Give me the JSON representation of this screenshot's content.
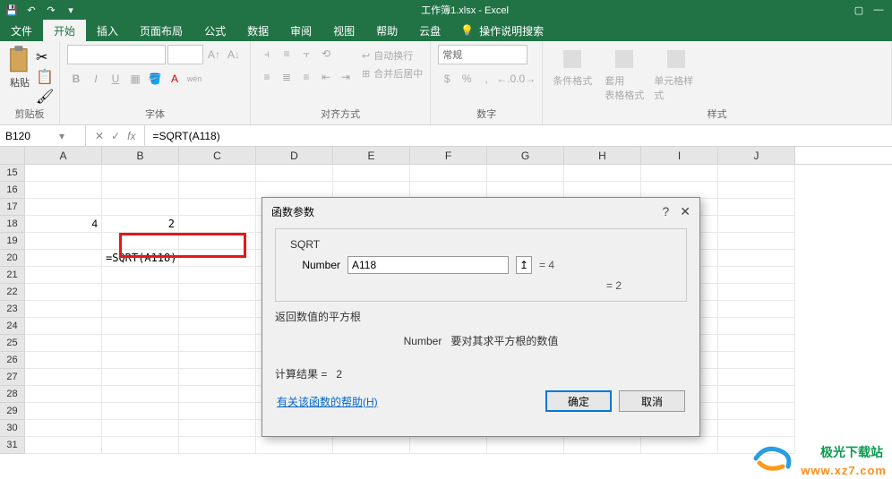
{
  "titlebar": {
    "title": "工作簿1.xlsx - Excel"
  },
  "tabs": {
    "file": "文件",
    "home": "开始",
    "insert": "插入",
    "layout": "页面布局",
    "formulas": "公式",
    "data": "数据",
    "review": "审阅",
    "view": "视图",
    "help": "帮助",
    "cloud": "云盘",
    "search": "操作说明搜索"
  },
  "ribbon": {
    "clipboard": {
      "paste": "粘贴",
      "label": "剪贴板"
    },
    "font": {
      "label": "字体",
      "bold": "B",
      "italic": "I",
      "underline": "U",
      "wen": "wén"
    },
    "align": {
      "label": "对齐方式",
      "wrap": "自动换行",
      "merge": "合并后居中"
    },
    "number": {
      "label": "数字",
      "format": "常规"
    },
    "styles": {
      "label": "样式",
      "cond": "条件格式",
      "table": "套用\n表格格式",
      "cell": "单元格样式"
    }
  },
  "formula_bar": {
    "name_box": "B120",
    "formula": "=SQRT(A118)"
  },
  "columns": [
    "A",
    "B",
    "C",
    "D",
    "E",
    "F",
    "G",
    "H",
    "I",
    "J"
  ],
  "rows": [
    "15",
    "16",
    "17",
    "18",
    "19",
    "20",
    "21",
    "22",
    "23",
    "24",
    "25",
    "26",
    "27",
    "28",
    "29",
    "30",
    "31"
  ],
  "cells": {
    "A18": "4",
    "B18": "2",
    "B20": "=SQRT(A118)"
  },
  "dialog": {
    "title": "函数参数",
    "func": "SQRT",
    "arg_label": "Number",
    "arg_value": "A118",
    "arg_result": "= 4",
    "result_eq": "= 2",
    "desc1": "返回数值的平方根",
    "desc2_label": "Number",
    "desc2_text": "要对其求平方根的数值",
    "calc_label": "计算结果 =",
    "calc_value": "2",
    "help": "有关该函数的帮助(H)",
    "ok": "确定",
    "cancel": "取消"
  },
  "watermark": {
    "cn": "极光下载站",
    "url": "www.xz7.com"
  }
}
